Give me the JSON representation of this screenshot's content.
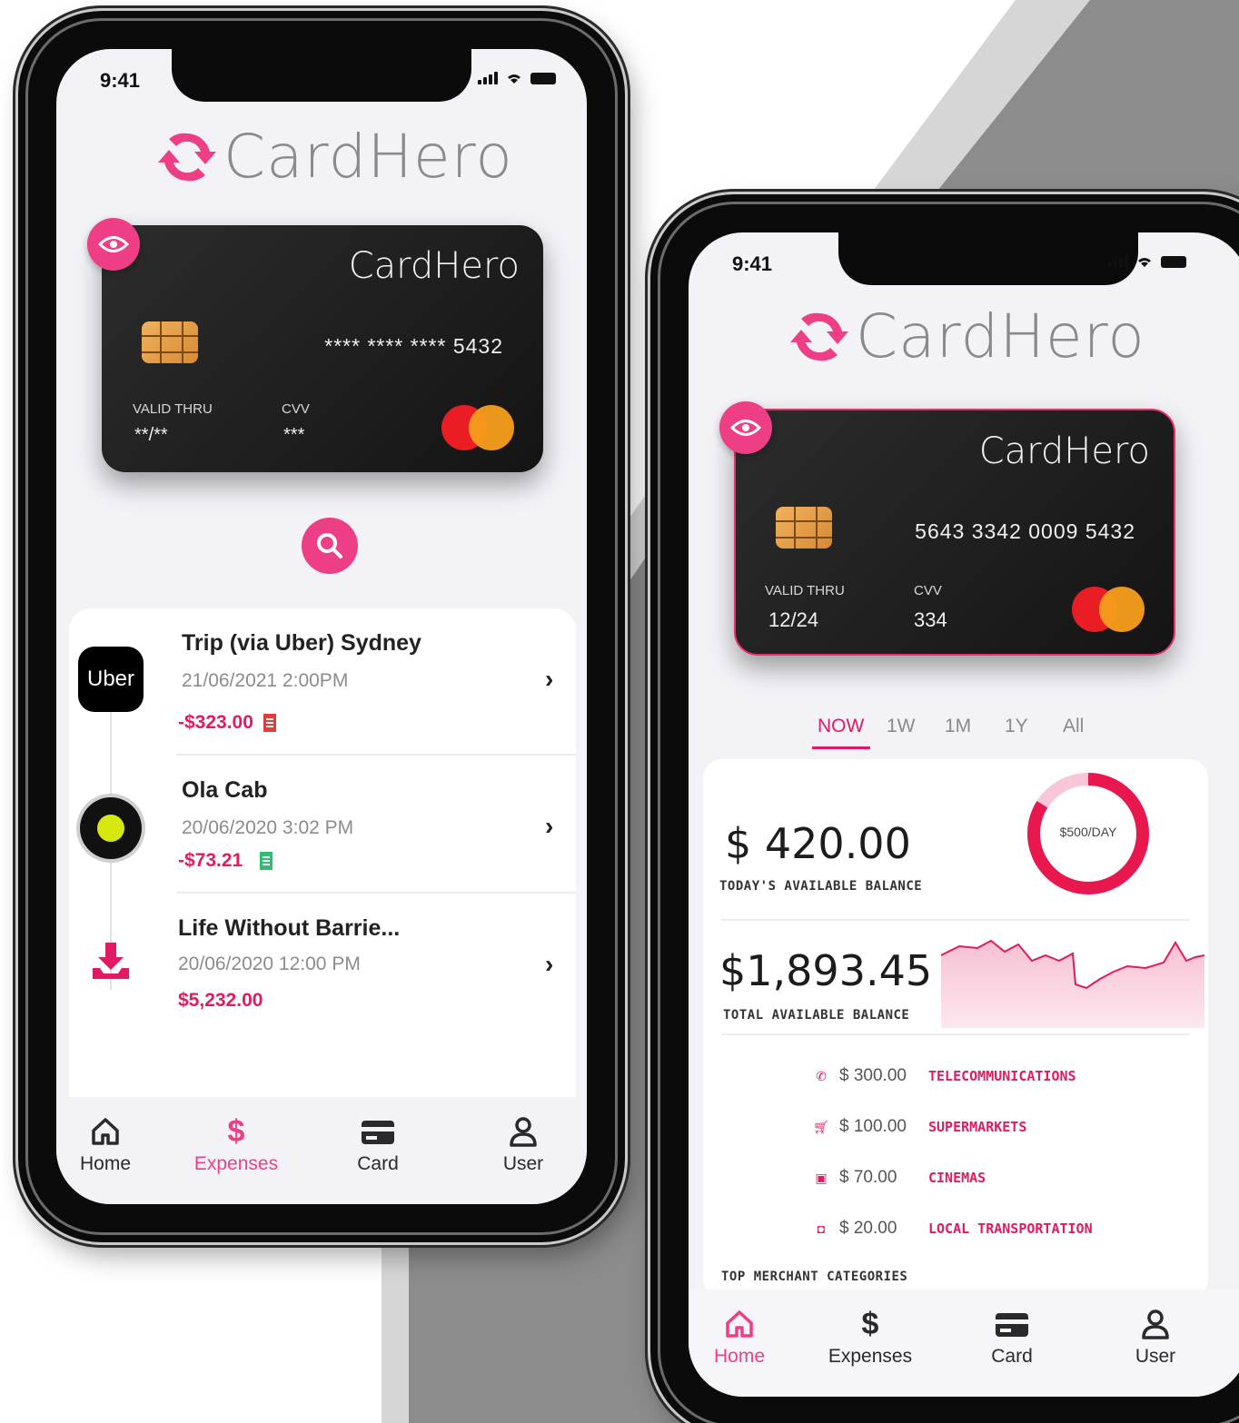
{
  "colors": {
    "accent": "#ee3f86",
    "accent_dark": "#e21a63",
    "screen_bg": "#f2f2f7",
    "card_bg": "#1c1c1c"
  },
  "left_phone": {
    "status_time": "9:41",
    "logo_text": "CardHero",
    "card": {
      "brand": "CardHero",
      "number": "****   ****   ****  5432",
      "valid_label": "VALID THRU",
      "valid_value": "**/**",
      "cvv_label": "CVV",
      "cvv_value": "***"
    },
    "transactions": [
      {
        "merchant_icon": "uber-logo",
        "logo_text": "Uber",
        "title": "Trip (via Uber) Sydney",
        "date": "21/06/2021 2:00PM",
        "amount": "-$323.00",
        "receipt_icon": "receipt-icon-red"
      },
      {
        "merchant_icon": "ola-logo",
        "title": "Ola Cab",
        "date": "20/06/2020 3:02 PM",
        "amount": "-$73.21",
        "receipt_icon": "receipt-icon-green"
      },
      {
        "merchant_icon": "download-icon",
        "title": "Life Without Barrie...",
        "date": "20/06/2020 12:00 PM",
        "amount": "$5,232.00"
      }
    ],
    "tabs": [
      {
        "label": "Home",
        "icon": "home-icon"
      },
      {
        "label": "Expenses",
        "icon": "dollar-icon",
        "active": true
      },
      {
        "label": "Card",
        "icon": "card-icon"
      },
      {
        "label": "User",
        "icon": "user-icon"
      }
    ]
  },
  "right_phone": {
    "status_time": "9:41",
    "logo_text": "CardHero",
    "card": {
      "brand": "CardHero",
      "number": "5643  3342  0009  5432",
      "valid_label": "VALID THRU",
      "valid_value": "12/24",
      "cvv_label": "CVV",
      "cvv_value": "334"
    },
    "periods": [
      "NOW",
      "1W",
      "1M",
      "1Y",
      "All"
    ],
    "active_period": "NOW",
    "today_balance": "$ 420.00",
    "today_label": "TODAY'S AVAILABLE BALANCE",
    "daily_limit": "$500/DAY",
    "daily_limit_used_fraction": 0.84,
    "total_balance": "$1,893.45",
    "total_label": "TOTAL AVAILABLE BALANCE",
    "categories": [
      {
        "icon": "phone-icon",
        "amount": "$ 300.00",
        "name": "TELECOMMUNICATIONS"
      },
      {
        "icon": "cart-icon",
        "amount": "$ 100.00",
        "name": "SUPERMARKETS"
      },
      {
        "icon": "ticket-icon",
        "amount": "$ 70.00",
        "name": "CINEMAS"
      },
      {
        "icon": "bus-icon",
        "amount": "$ 20.00",
        "name": "LOCAL TRANSPORTATION"
      }
    ],
    "categories_title": "TOP MERCHANT CATEGORIES",
    "tabs": [
      {
        "label": "Home",
        "icon": "home-icon",
        "active": true
      },
      {
        "label": "Expenses",
        "icon": "dollar-icon"
      },
      {
        "label": "Card",
        "icon": "card-icon"
      },
      {
        "label": "User",
        "icon": "user-icon"
      }
    ]
  }
}
